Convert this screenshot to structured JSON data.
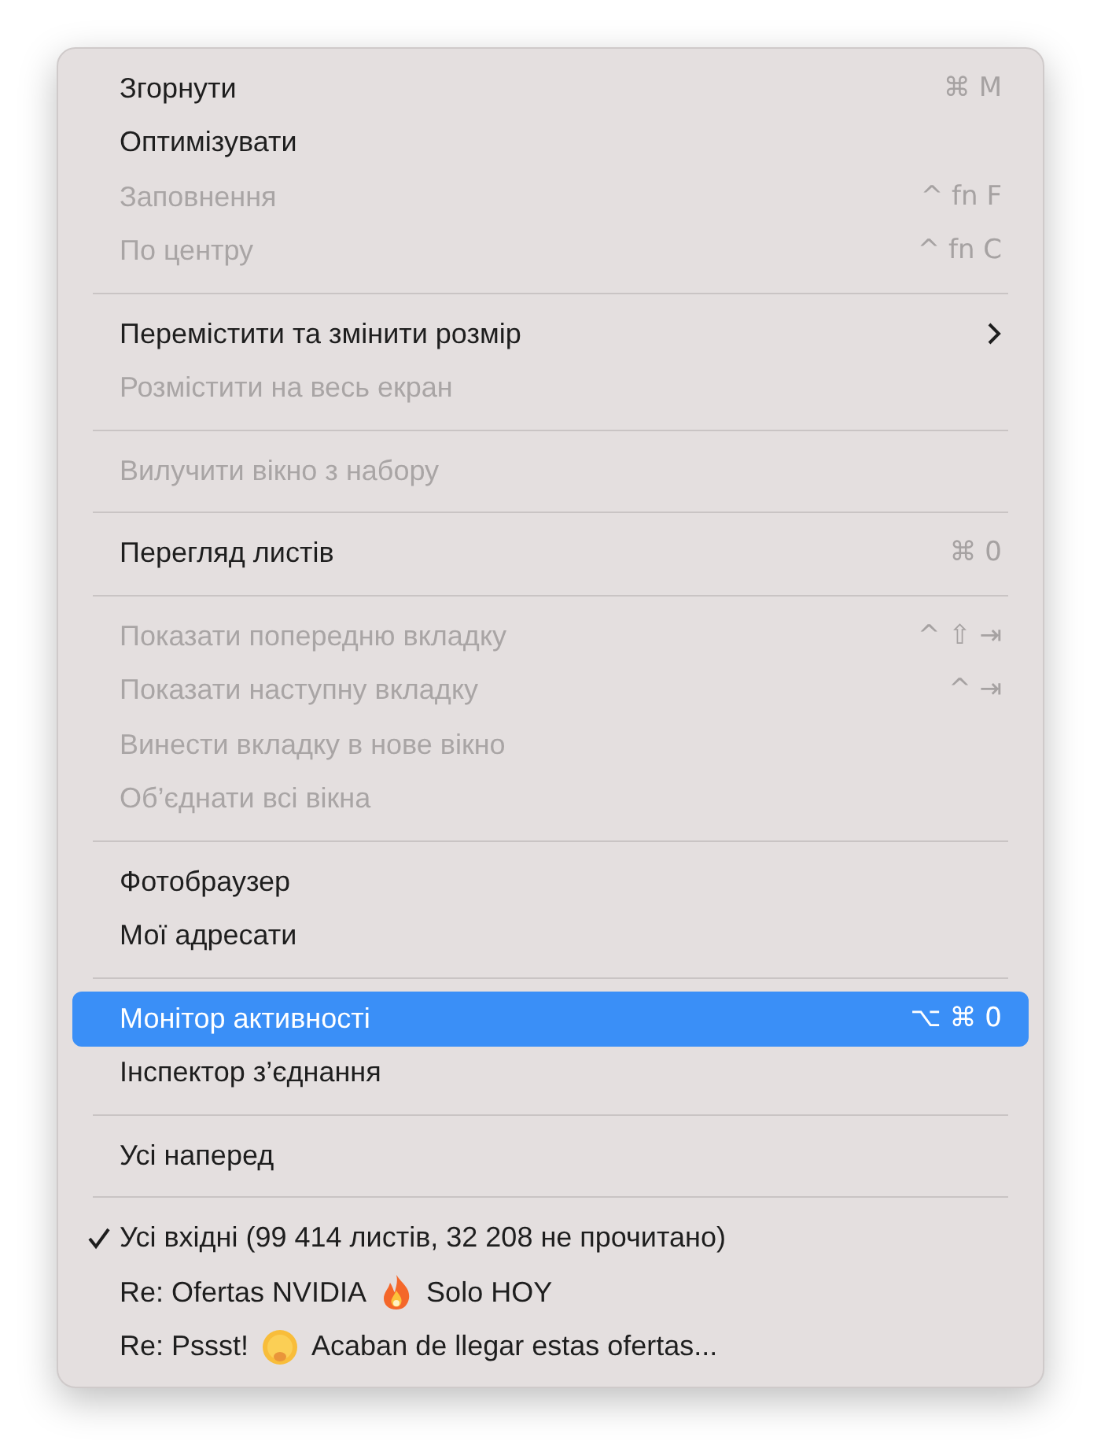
{
  "menu": {
    "sections": [
      {
        "items": [
          {
            "label": "Згорнути",
            "shortcut": "⌘ M",
            "disabled": false,
            "selected": false,
            "checked": false,
            "submenu": false
          },
          {
            "label": "Оптимізувати",
            "disabled": false,
            "selected": false,
            "checked": false,
            "submenu": false
          },
          {
            "label": "Заповнення",
            "shortcut": "^ fn F",
            "disabled": true,
            "selected": false,
            "checked": false,
            "submenu": false
          },
          {
            "label": "По центру",
            "shortcut": "^ fn C",
            "disabled": true,
            "selected": false,
            "checked": false,
            "submenu": false
          }
        ]
      },
      {
        "items": [
          {
            "label": "Перемістити та змінити розмір",
            "disabled": false,
            "selected": false,
            "checked": false,
            "submenu": true
          },
          {
            "label": "Розмістити на весь екран",
            "disabled": true,
            "selected": false,
            "checked": false,
            "submenu": false
          }
        ]
      },
      {
        "items": [
          {
            "label": "Вилучити вікно з набору",
            "disabled": true,
            "selected": false,
            "checked": false,
            "submenu": false
          }
        ]
      },
      {
        "items": [
          {
            "label": "Перегляд листів",
            "shortcut": "⌘ 0",
            "disabled": false,
            "selected": false,
            "checked": false,
            "submenu": false
          }
        ]
      },
      {
        "items": [
          {
            "label": "Показати попередню вкладку",
            "shortcut": "^ ⇧ ⇥",
            "disabled": true,
            "selected": false,
            "checked": false,
            "submenu": false
          },
          {
            "label": "Показати наступну вкладку",
            "shortcut": "^ ⇥",
            "disabled": true,
            "selected": false,
            "checked": false,
            "submenu": false
          },
          {
            "label": "Винести вкладку в нове вікно",
            "disabled": true,
            "selected": false,
            "checked": false,
            "submenu": false
          },
          {
            "label": "Об’єднати всі вікна",
            "disabled": true,
            "selected": false,
            "checked": false,
            "submenu": false
          }
        ]
      },
      {
        "items": [
          {
            "label": "Фотобраузер",
            "disabled": false,
            "selected": false,
            "checked": false,
            "submenu": false
          },
          {
            "label": "Мої адресати",
            "disabled": false,
            "selected": false,
            "checked": false,
            "submenu": false
          }
        ]
      },
      {
        "items": [
          {
            "label": "Монітор активності",
            "shortcut": "⌥ ⌘ 0",
            "disabled": false,
            "selected": true,
            "checked": false,
            "submenu": false
          },
          {
            "label": "Інспектор з’єднання",
            "disabled": false,
            "selected": false,
            "checked": false,
            "submenu": false
          }
        ]
      },
      {
        "items": [
          {
            "label": "Усі наперед",
            "disabled": false,
            "selected": false,
            "checked": false,
            "submenu": false
          }
        ]
      },
      {
        "items": [
          {
            "label": "Усі вхідні (99 414 листів, 32 208 не прочитано)",
            "disabled": false,
            "selected": false,
            "checked": true,
            "submenu": false
          },
          {
            "kind": "flame",
            "before": "Re: Ofertas NVIDIA",
            "after": "Solo HOY",
            "disabled": false,
            "selected": false,
            "checked": false,
            "submenu": false
          },
          {
            "kind": "face",
            "before": "Re: Pssst!",
            "after": "Acaban de llegar estas ofertas...",
            "disabled": false,
            "selected": false,
            "checked": false,
            "submenu": false
          }
        ]
      }
    ]
  }
}
